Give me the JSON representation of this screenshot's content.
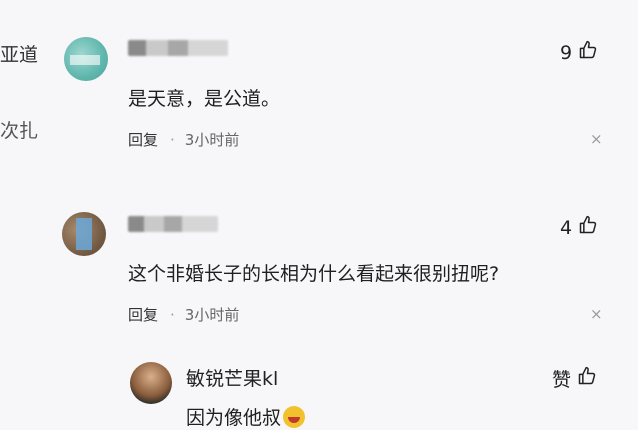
{
  "edge": {
    "line1": "亚道",
    "line2": "次扎"
  },
  "comments": [
    {
      "text": "是天意，是公道。",
      "likes": "9",
      "reply_label": "回复",
      "separator": "·",
      "time": "3小时前",
      "close": "×"
    },
    {
      "text": "这个非婚长子的长相为什么看起来很别扭呢?",
      "likes": "4",
      "reply_label": "回复",
      "separator": "·",
      "time": "3小时前",
      "close": "×"
    }
  ],
  "reply": {
    "author": "敏锐芒果kl",
    "text": "因为像他叔",
    "like_label": "赞"
  },
  "colors": {
    "background": "#f7f7f9",
    "text": "#222222",
    "muted": "#999999"
  }
}
